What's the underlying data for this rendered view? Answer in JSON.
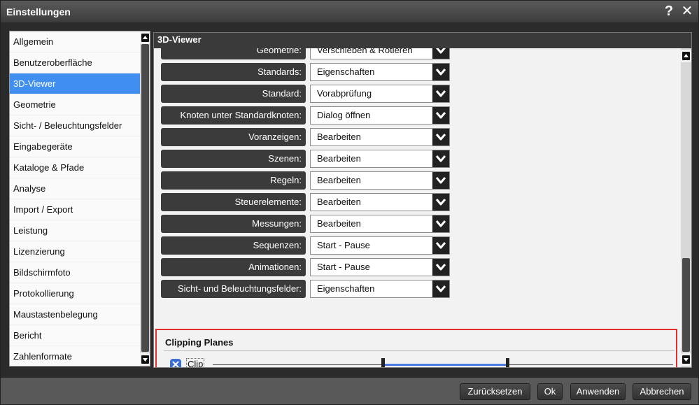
{
  "window": {
    "title": "Einstellungen",
    "help_label": "?",
    "close_label": "✕"
  },
  "sidebar": {
    "items": [
      {
        "label": "Allgemein",
        "selected": false
      },
      {
        "label": "Benutzeroberfläche",
        "selected": false
      },
      {
        "label": "3D-Viewer",
        "selected": true
      },
      {
        "label": "Geometrie",
        "selected": false
      },
      {
        "label": "Sicht- / Beleuchtungsfelder",
        "selected": false
      },
      {
        "label": "Eingabegeräte",
        "selected": false
      },
      {
        "label": "Kataloge & Pfade",
        "selected": false
      },
      {
        "label": "Analyse",
        "selected": false
      },
      {
        "label": "Import / Export",
        "selected": false
      },
      {
        "label": "Leistung",
        "selected": false
      },
      {
        "label": "Lizenzierung",
        "selected": false
      },
      {
        "label": "Bildschirmfoto",
        "selected": false
      },
      {
        "label": "Protokollierung",
        "selected": false
      },
      {
        "label": "Maustastenbelegung",
        "selected": false
      },
      {
        "label": "Bericht",
        "selected": false
      },
      {
        "label": "Zahlenformate",
        "selected": false
      }
    ]
  },
  "panel": {
    "header": "3D-Viewer",
    "rows": [
      {
        "label": "Geometrie:",
        "value": "Verschieben & Rotieren"
      },
      {
        "label": "Standards:",
        "value": "Eigenschaften"
      },
      {
        "label": "Standard:",
        "value": "Vorabprüfung"
      },
      {
        "label": "Knoten unter Standardknoten:",
        "value": "Dialog öffnen"
      },
      {
        "label": "Voranzeigen:",
        "value": "Bearbeiten"
      },
      {
        "label": "Szenen:",
        "value": "Bearbeiten"
      },
      {
        "label": "Regeln:",
        "value": "Bearbeiten"
      },
      {
        "label": "Steuerelemente:",
        "value": "Bearbeiten"
      },
      {
        "label": "Messungen:",
        "value": "Bearbeiten"
      },
      {
        "label": "Sequenzen:",
        "value": "Start - Pause"
      },
      {
        "label": "Animationen:",
        "value": "Start - Pause"
      },
      {
        "label": "Sicht- und Beleuchtungsfelder:",
        "value": "Eigenschaften"
      }
    ],
    "clipping": {
      "title": "Clipping Planes",
      "checkbox_label": "Clip",
      "checked": true,
      "range_start": 0.37,
      "range_end": 0.64
    }
  },
  "footer": {
    "reset_label": "Zurücksetzen",
    "ok_label": "Ok",
    "apply_label": "Anwenden",
    "cancel_label": "Abbrechen"
  },
  "colors": {
    "selection": "#3f8ef0",
    "highlight_border": "#e03030",
    "slider_range": "#4a7ee6"
  }
}
